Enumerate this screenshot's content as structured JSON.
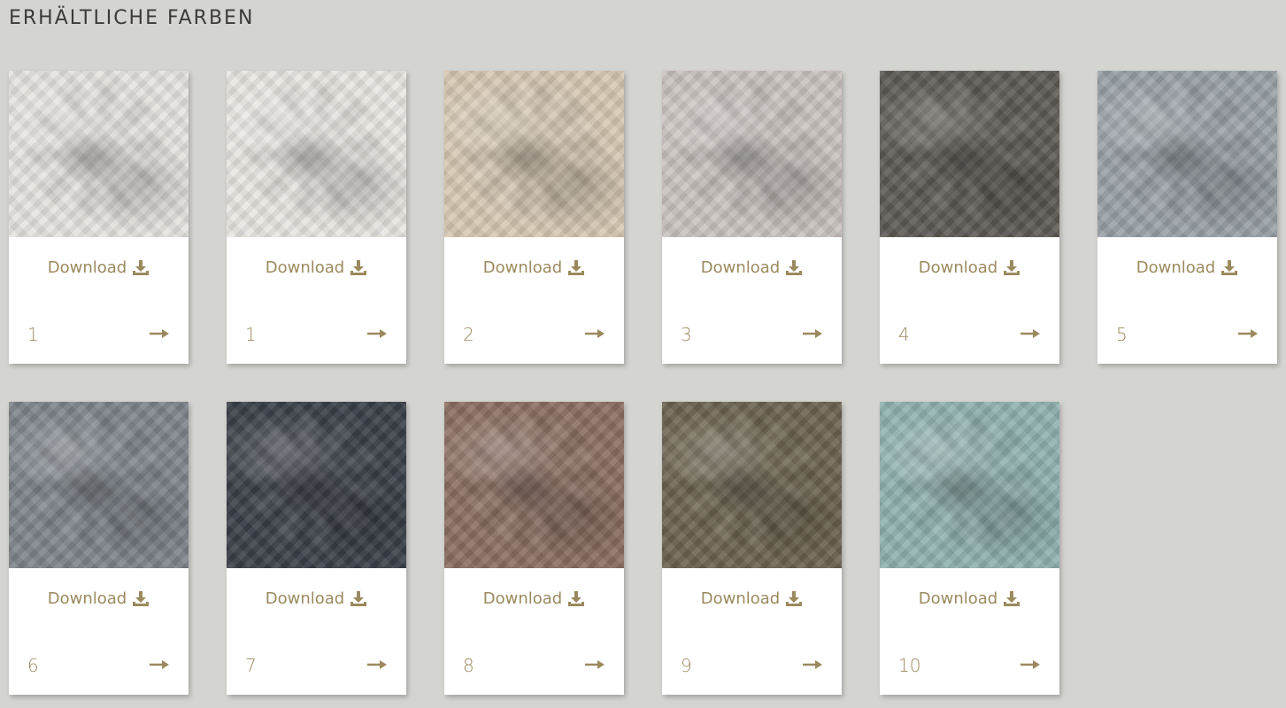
{
  "section": {
    "title": "ERHÄLTLICHE FARBEN"
  },
  "accent_color": "#9b8a5f",
  "icons": {
    "download": "download-icon",
    "arrow": "arrow-right-icon"
  },
  "cards": [
    {
      "number": "1",
      "download_label": "Download",
      "swatch_color": "#e6e4df"
    },
    {
      "number": "1",
      "download_label": "Download",
      "swatch_color": "#e9e7e2"
    },
    {
      "number": "2",
      "download_label": "Download",
      "swatch_color": "#d7c8b3"
    },
    {
      "number": "3",
      "download_label": "Download",
      "swatch_color": "#cac4c0"
    },
    {
      "number": "4",
      "download_label": "Download",
      "swatch_color": "#5f5b55"
    },
    {
      "number": "5",
      "download_label": "Download",
      "swatch_color": "#9aa2a8"
    },
    {
      "number": "6",
      "download_label": "Download",
      "swatch_color": "#7f858c"
    },
    {
      "number": "7",
      "download_label": "Download",
      "swatch_color": "#3b4049"
    },
    {
      "number": "8",
      "download_label": "Download",
      "swatch_color": "#8d6f63"
    },
    {
      "number": "9",
      "download_label": "Download",
      "swatch_color": "#6d6451"
    },
    {
      "number": "10",
      "download_label": "Download",
      "swatch_color": "#8fb2b0"
    }
  ]
}
